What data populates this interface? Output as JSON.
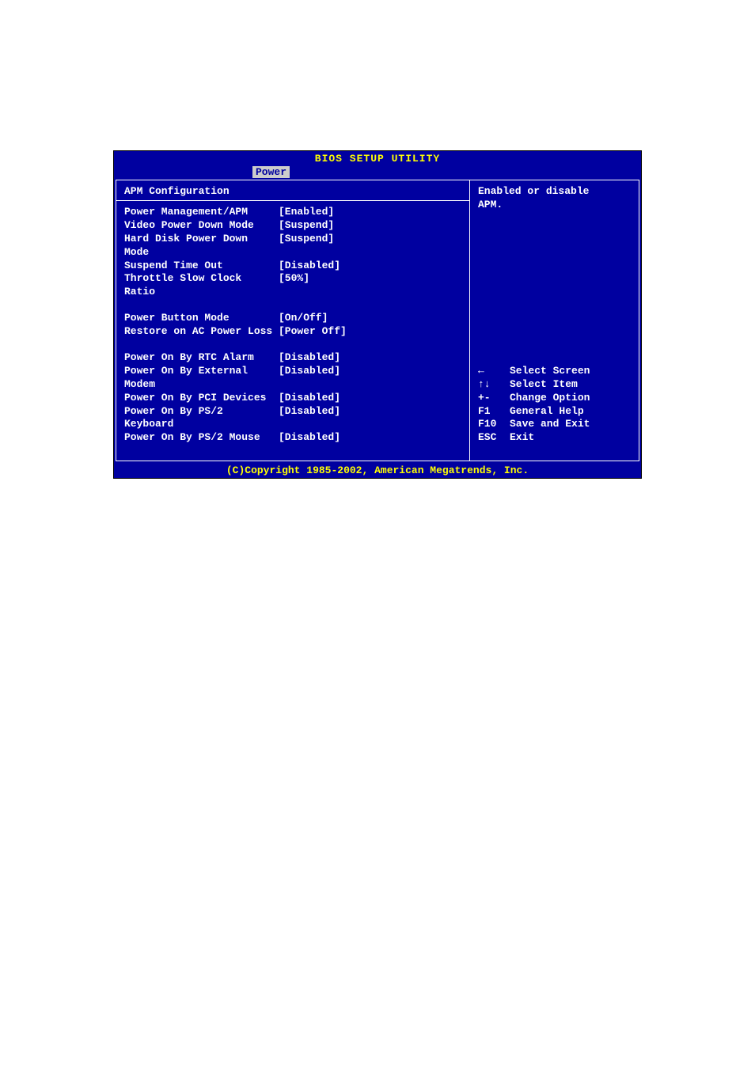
{
  "title": "BIOS SETUP UTILITY",
  "tab": "Power",
  "section_title": "APM Configuration",
  "settings_group1": [
    {
      "label": "Power Management/APM",
      "value": "[Enabled]"
    },
    {
      "label": "Video Power Down Mode",
      "value": "[Suspend]"
    },
    {
      "label": "Hard Disk Power Down Mode",
      "value": "[Suspend]"
    },
    {
      "label": "Suspend Time Out",
      "value": "[Disabled]"
    },
    {
      "label": "Throttle Slow Clock Ratio",
      "value": "[50%]"
    }
  ],
  "settings_group2": [
    {
      "label": "Power Button Mode",
      "value": "[On/Off]"
    },
    {
      "label": "Restore on AC Power Loss",
      "value": "[Power Off]"
    }
  ],
  "settings_group3": [
    {
      "label": "Power On By RTC Alarm",
      "value": "[Disabled]"
    },
    {
      "label": "Power On By External Modem",
      "value": "[Disabled]"
    },
    {
      "label": "Power On By PCI Devices",
      "value": "[Disabled]"
    },
    {
      "label": "Power On By PS/2 Keyboard",
      "value": "[Disabled]"
    },
    {
      "label": "Power On By PS/2 Mouse",
      "value": "[Disabled]"
    }
  ],
  "help_text_line1": "Enabled or disable",
  "help_text_line2": "APM.",
  "nav": [
    {
      "key": "←",
      "desc": "Select Screen"
    },
    {
      "key": "↑↓",
      "desc": "Select Item"
    },
    {
      "key": "+-",
      "desc": "Change Option"
    },
    {
      "key": "F1",
      "desc": "General Help"
    },
    {
      "key": "F10",
      "desc": "Save and Exit"
    },
    {
      "key": "ESC",
      "desc": "Exit"
    }
  ],
  "footer": "(C)Copyright 1985-2002, American Megatrends, Inc."
}
